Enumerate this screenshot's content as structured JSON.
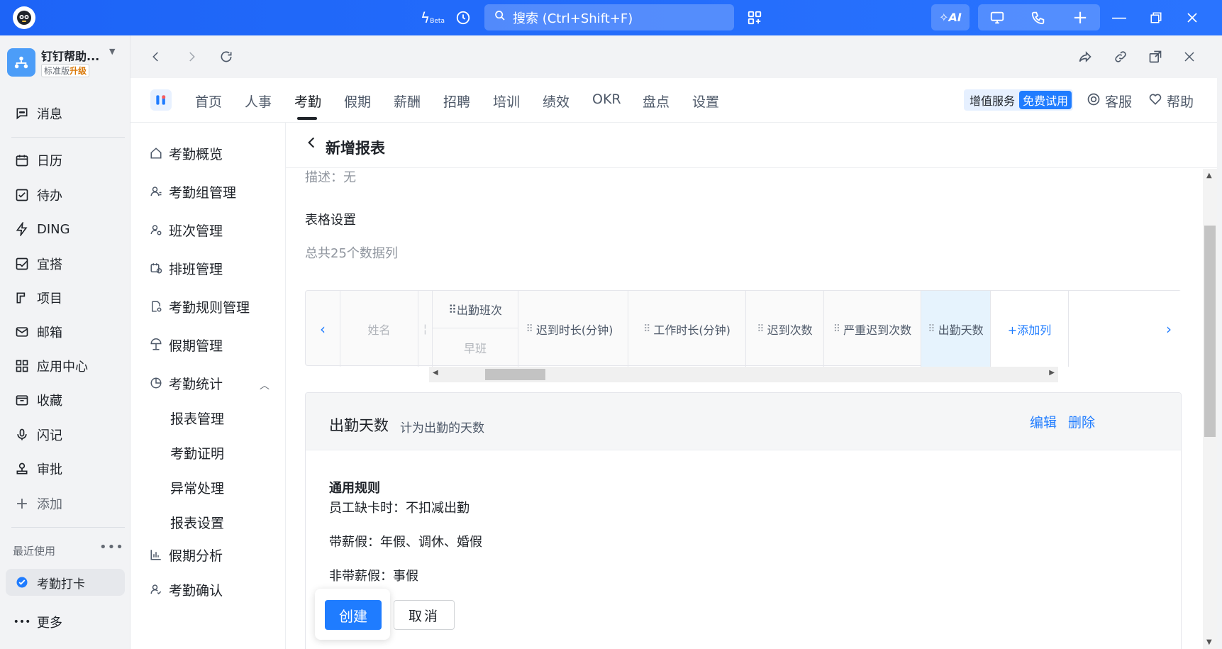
{
  "titlebar": {
    "search_placeholder": "搜索 (Ctrl+Shift+F)",
    "beta_label": "Beta",
    "ai_label": "AI"
  },
  "org": {
    "name": "钉钉帮助...",
    "edition": "标准版",
    "upgrade": "升级"
  },
  "leftnav": {
    "items": [
      {
        "label": "消息",
        "icon": "message-icon"
      },
      {
        "label": "日历",
        "icon": "calendar-icon"
      },
      {
        "label": "待办",
        "icon": "todo-icon"
      },
      {
        "label": "DING",
        "icon": "ding-icon"
      },
      {
        "label": "宜搭",
        "icon": "yida-icon"
      },
      {
        "label": "项目",
        "icon": "project-icon"
      },
      {
        "label": "邮箱",
        "icon": "mail-icon"
      },
      {
        "label": "应用中心",
        "icon": "apps-icon"
      },
      {
        "label": "收藏",
        "icon": "favorites-icon"
      },
      {
        "label": "闪记",
        "icon": "flash-note-icon"
      },
      {
        "label": "审批",
        "icon": "approval-icon"
      },
      {
        "label": "添加",
        "icon": "plus-icon"
      }
    ],
    "recent_label": "最近使用",
    "recent_item": "考勤打卡",
    "more": "更多"
  },
  "appbar": {
    "tabs": [
      "首页",
      "人事",
      "考勤",
      "假期",
      "薪酬",
      "招聘",
      "培训",
      "绩效",
      "OKR",
      "盘点",
      "设置"
    ],
    "active_tab": "考勤",
    "value_service": "增值服务",
    "free_trial": "免费试用",
    "customer_service": "客服",
    "help": "帮助"
  },
  "subnav": {
    "items": [
      "考勤概览",
      "考勤组管理",
      "班次管理",
      "排班管理",
      "考勤规则管理",
      "假期管理",
      "考勤统计"
    ],
    "children": [
      "报表管理",
      "考勤证明",
      "异常处理",
      "报表设置"
    ],
    "after": [
      "假期分析",
      "考勤确认"
    ]
  },
  "main": {
    "title": "新增报表",
    "description": "描述：无",
    "table_settings_title": "表格设置",
    "total_columns": "总共25个数据列",
    "columns": {
      "name": "姓名",
      "shift": "出勤班次",
      "shift_sub": "早班",
      "late_duration": "迟到时长(分钟)",
      "work_duration": "工作时长(分钟)",
      "late_count": "迟到次数",
      "severe_late_count": "严重迟到次数",
      "attendance_days": "出勤天数",
      "add_column": "+添加列"
    },
    "detail": {
      "title": "出勤天数",
      "subtitle": "计为出勤的天数",
      "edit": "编辑",
      "delete": "删除",
      "rule_heading": "通用规则",
      "rules": [
        "员工缺卡时：不扣减出勤",
        "带薪假：年假、调休、婚假",
        "非带薪假：事假"
      ]
    },
    "create": "创建",
    "cancel": "取消"
  }
}
